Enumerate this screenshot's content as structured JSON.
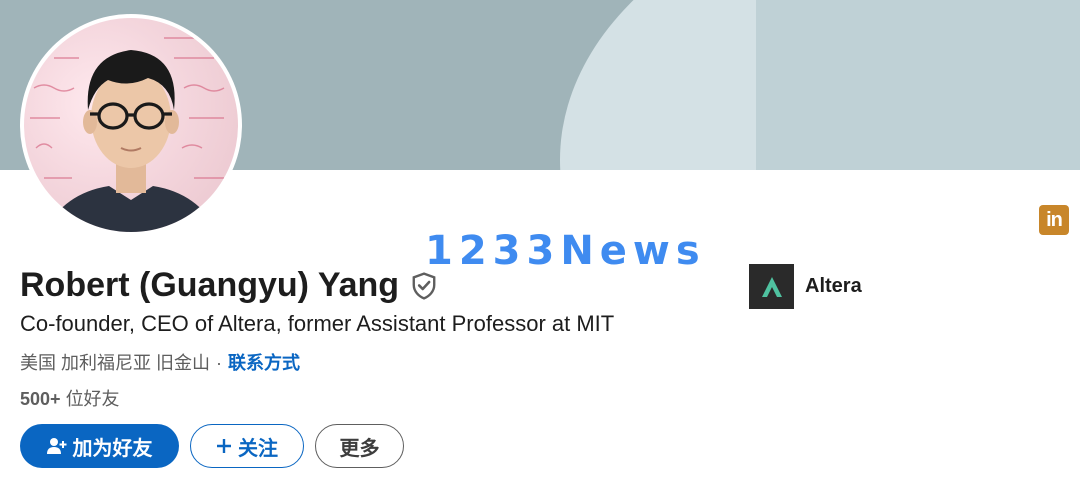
{
  "profile": {
    "name": "Robert (Guangyu) Yang",
    "headline": "Co-founder, CEO of Altera, former Assistant Professor at MIT",
    "location": "美国 加利福尼亚 旧金山",
    "separator": "·",
    "contact_label": "联系方式",
    "connections_count": "500+",
    "connections_label": "位好友"
  },
  "company": {
    "name": "Altera"
  },
  "actions": {
    "connect_label": "加为好友",
    "follow_label": "关注",
    "more_label": "更多"
  },
  "watermark": {
    "text": "1233News"
  },
  "brand": {
    "badge_text": "in",
    "primary_color": "#0a66c2",
    "badge_color": "#c8862a"
  },
  "icons": {
    "verified": "shield-check-icon",
    "add_user": "add-user-icon",
    "plus": "plus-icon",
    "linkedin": "linkedin-icon",
    "company_logo": "altera-logo-icon"
  }
}
